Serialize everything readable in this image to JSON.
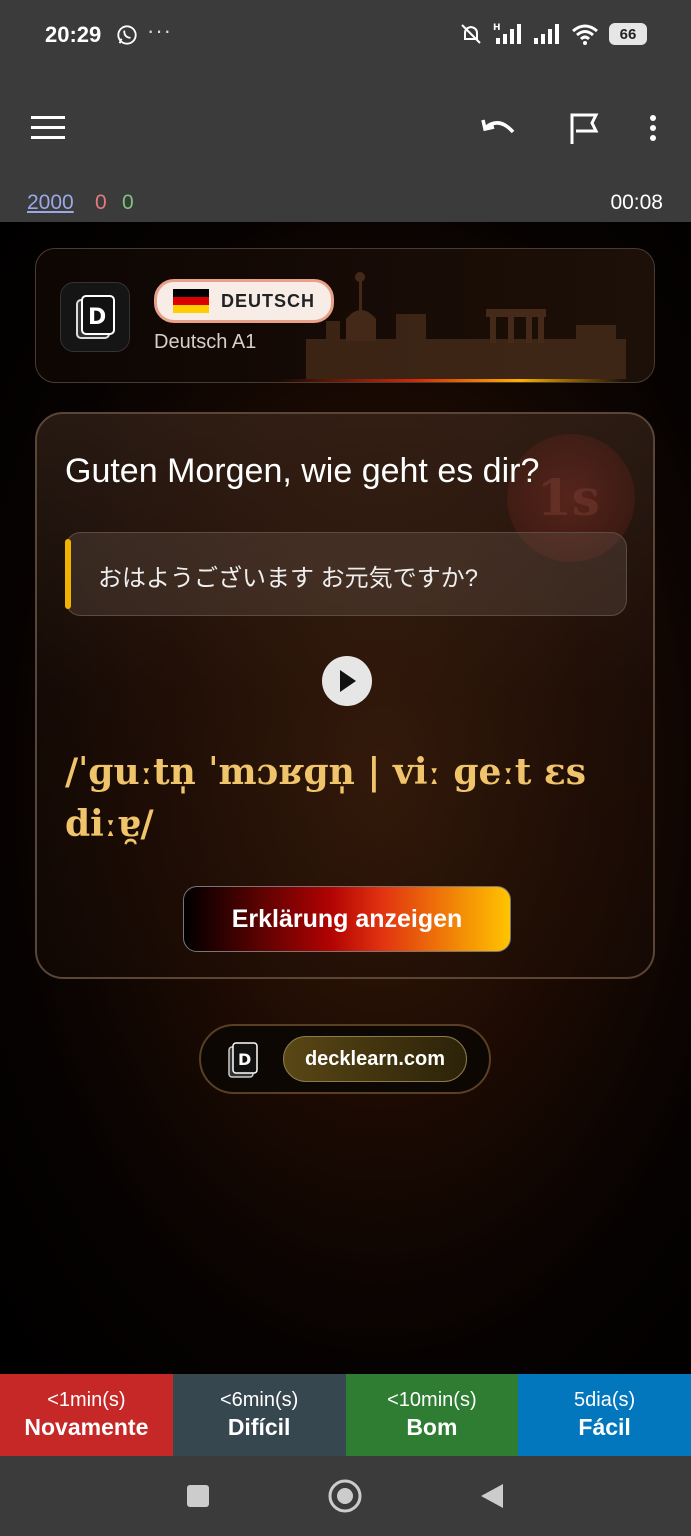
{
  "status_bar": {
    "time": "20:29",
    "more": "···",
    "battery": "66"
  },
  "toolbar": {
    "icons": {
      "menu": "hamburger-menu-icon",
      "undo": "undo-icon",
      "flag": "flag-icon",
      "more": "more-vert-icon"
    }
  },
  "counts": {
    "new": "2000",
    "learning": "0",
    "review": "0",
    "timer": "00:08"
  },
  "colors": {
    "new": "#9aa8e6",
    "learning": "#e47b7b",
    "review": "#7cc37a",
    "ipa": "#f0c46a",
    "accent": "#f0b400"
  },
  "header": {
    "language_label": "DEUTSCH",
    "deck_name": "Deutsch A1"
  },
  "card": {
    "question": "Guten Morgen, wie geht es dir?",
    "translation": "おはようございます お元気ですか?",
    "ipa": "/ˈɡuːtn̩ ˈmɔʁɡn̩ | viː ɡeːt ɛs diːɐ̯/",
    "explain_button": "Erklärung anzeigen"
  },
  "footer": {
    "site": "decklearn.com"
  },
  "answers": [
    {
      "time": "<1min(s)",
      "label": "Novamente"
    },
    {
      "time": "<6min(s)",
      "label": "Difícil"
    },
    {
      "time": "<10min(s)",
      "label": "Bom"
    },
    {
      "time": "5dia(s)",
      "label": "Fácil"
    }
  ]
}
